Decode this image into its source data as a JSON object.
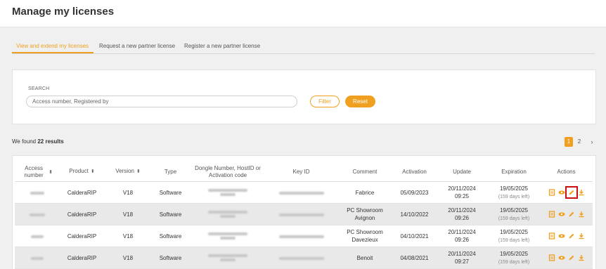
{
  "page": {
    "title": "Manage my licenses"
  },
  "tabs": [
    {
      "label": "View and extend my licenses",
      "active": true
    },
    {
      "label": "Request a new partner license",
      "active": false
    },
    {
      "label": "Register a new partner license",
      "active": false
    }
  ],
  "search": {
    "label": "SEARCH",
    "placeholder": "Access number, Registered by",
    "value": "",
    "filter_label": "Filter",
    "reset_label": "Reset"
  },
  "results": {
    "prefix": "We found",
    "count_text": "22 results"
  },
  "pagination": {
    "pages": [
      "1",
      "2"
    ],
    "current": "1",
    "next_glyph": "›"
  },
  "table": {
    "columns": {
      "access": "Access number",
      "product": "Product",
      "version": "Version",
      "type": "Type",
      "dongle": "Dongle Number, HostID or Activation code",
      "keyid": "Key ID",
      "comment": "Comment",
      "activation": "Activation",
      "update": "Update",
      "expiration": "Expiration",
      "actions": "Actions"
    },
    "sort_glyph": "⬍",
    "rows": [
      {
        "product": "CalderaRIP",
        "version": "V18",
        "type": "Software",
        "comment": "Fabrice",
        "activation": "05/09/2023",
        "update_date": "20/11/2024",
        "update_time": "09:25",
        "expiration": "19/05/2025",
        "days_left": "(159 days left)"
      },
      {
        "product": "CalderaRIP",
        "version": "V18",
        "type": "Software",
        "comment": "PC Showroom Avignon",
        "activation": "14/10/2022",
        "update_date": "20/11/2024",
        "update_time": "09:26",
        "expiration": "19/05/2025",
        "days_left": "(159 days left)"
      },
      {
        "product": "CalderaRIP",
        "version": "V18",
        "type": "Software",
        "comment": "PC Showroom Davezieux",
        "activation": "04/10/2021",
        "update_date": "20/11/2024",
        "update_time": "09:26",
        "expiration": "19/05/2025",
        "days_left": "(159 days left)"
      },
      {
        "product": "CalderaRIP",
        "version": "V18",
        "type": "Software",
        "comment": "Benoit",
        "activation": "04/08/2021",
        "update_date": "20/11/2024",
        "update_time": "09:27",
        "expiration": "19/05/2025",
        "days_left": "(159 days left)"
      }
    ],
    "action_icons": [
      "document-icon",
      "eye-icon",
      "pencil-icon",
      "download-icon"
    ]
  },
  "colors": {
    "accent": "#f0a020",
    "highlight": "#cc1010",
    "background": "#f0f0f0"
  }
}
